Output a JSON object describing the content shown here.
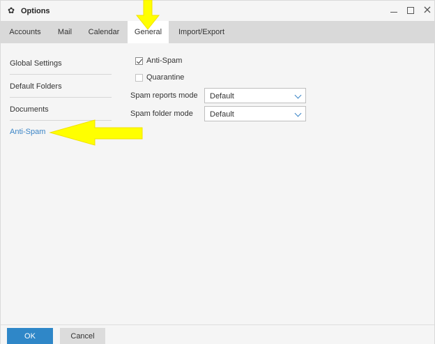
{
  "window": {
    "title": "Options",
    "icon": "gear-icon"
  },
  "tabs": [
    {
      "label": "Accounts",
      "active": false
    },
    {
      "label": "Mail",
      "active": false
    },
    {
      "label": "Calendar",
      "active": false
    },
    {
      "label": "General",
      "active": true
    },
    {
      "label": "Import/Export",
      "active": false
    }
  ],
  "sidebar": {
    "items": [
      {
        "label": "Global Settings",
        "active": false
      },
      {
        "label": "Default Folders",
        "active": false
      },
      {
        "label": "Documents",
        "active": false
      },
      {
        "label": "Anti-Spam",
        "active": true
      }
    ]
  },
  "antispam": {
    "antispam_checkbox": {
      "label": "Anti-Spam",
      "checked": true
    },
    "quarantine_checkbox": {
      "label": "Quarantine",
      "checked": false
    },
    "spam_reports_mode": {
      "label": "Spam reports mode",
      "value": "Default"
    },
    "spam_folder_mode": {
      "label": "Spam folder mode",
      "value": "Default"
    }
  },
  "footer": {
    "ok_label": "OK",
    "cancel_label": "Cancel"
  },
  "colors": {
    "accent": "#2f87c8",
    "active_link": "#3a84c6",
    "annotation_arrow": "#ffff00"
  }
}
